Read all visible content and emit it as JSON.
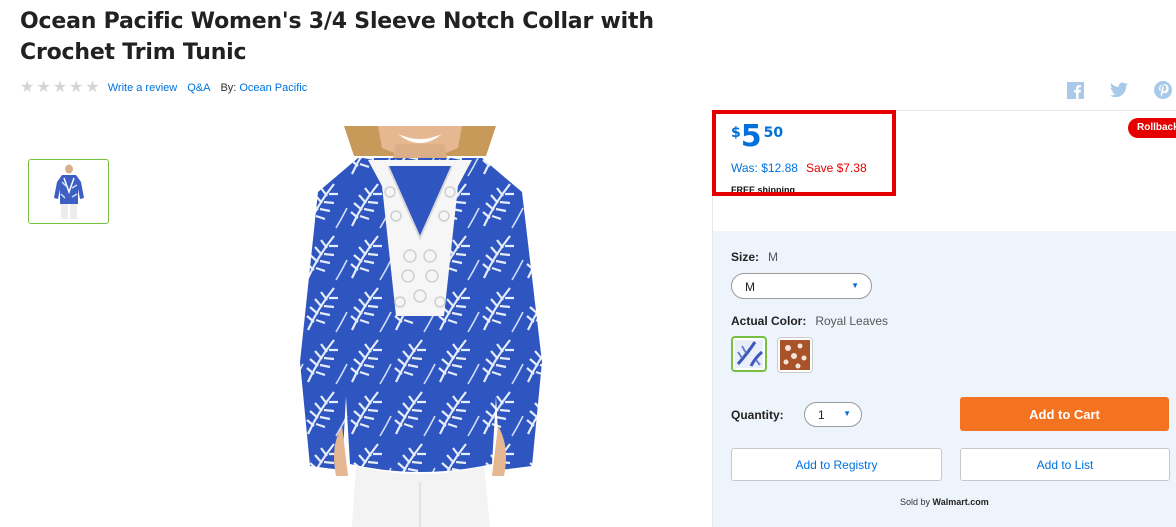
{
  "product": {
    "title": "Ocean Pacific Women's 3/4 Sleeve Notch Collar with Crochet Trim Tunic",
    "rating_stars": 5,
    "write_review": "Write a review",
    "qa": "Q&A",
    "by_label": "By:",
    "brand": "Ocean Pacific"
  },
  "social": {
    "icons": [
      "facebook-icon",
      "twitter-icon",
      "pinterest-icon"
    ]
  },
  "price": {
    "currency": "$",
    "dollars": "5",
    "cents": "50",
    "was": "Was: $12.88",
    "save": "Save $7.38",
    "shipping": "FREE shipping",
    "badge": "Rollback"
  },
  "options": {
    "size_label": "Size:",
    "size_value": "M",
    "size_selected": "M",
    "color_label": "Actual Color:",
    "color_value": "Royal Leaves",
    "swatches": [
      "Royal Leaves",
      "Rust"
    ],
    "quantity_label": "Quantity:",
    "quantity_value": "1"
  },
  "actions": {
    "add_to_cart": "Add to Cart",
    "add_to_registry": "Add to Registry",
    "add_to_list": "Add to List"
  },
  "seller": {
    "prefix": "Sold by",
    "name": "Walmart.com"
  },
  "colors": {
    "accent_blue": "#0071dc",
    "rollback_red": "#e40000",
    "cart_orange": "#f47321",
    "selected_green": "#76c043",
    "panel_bg": "#eef4fc"
  }
}
